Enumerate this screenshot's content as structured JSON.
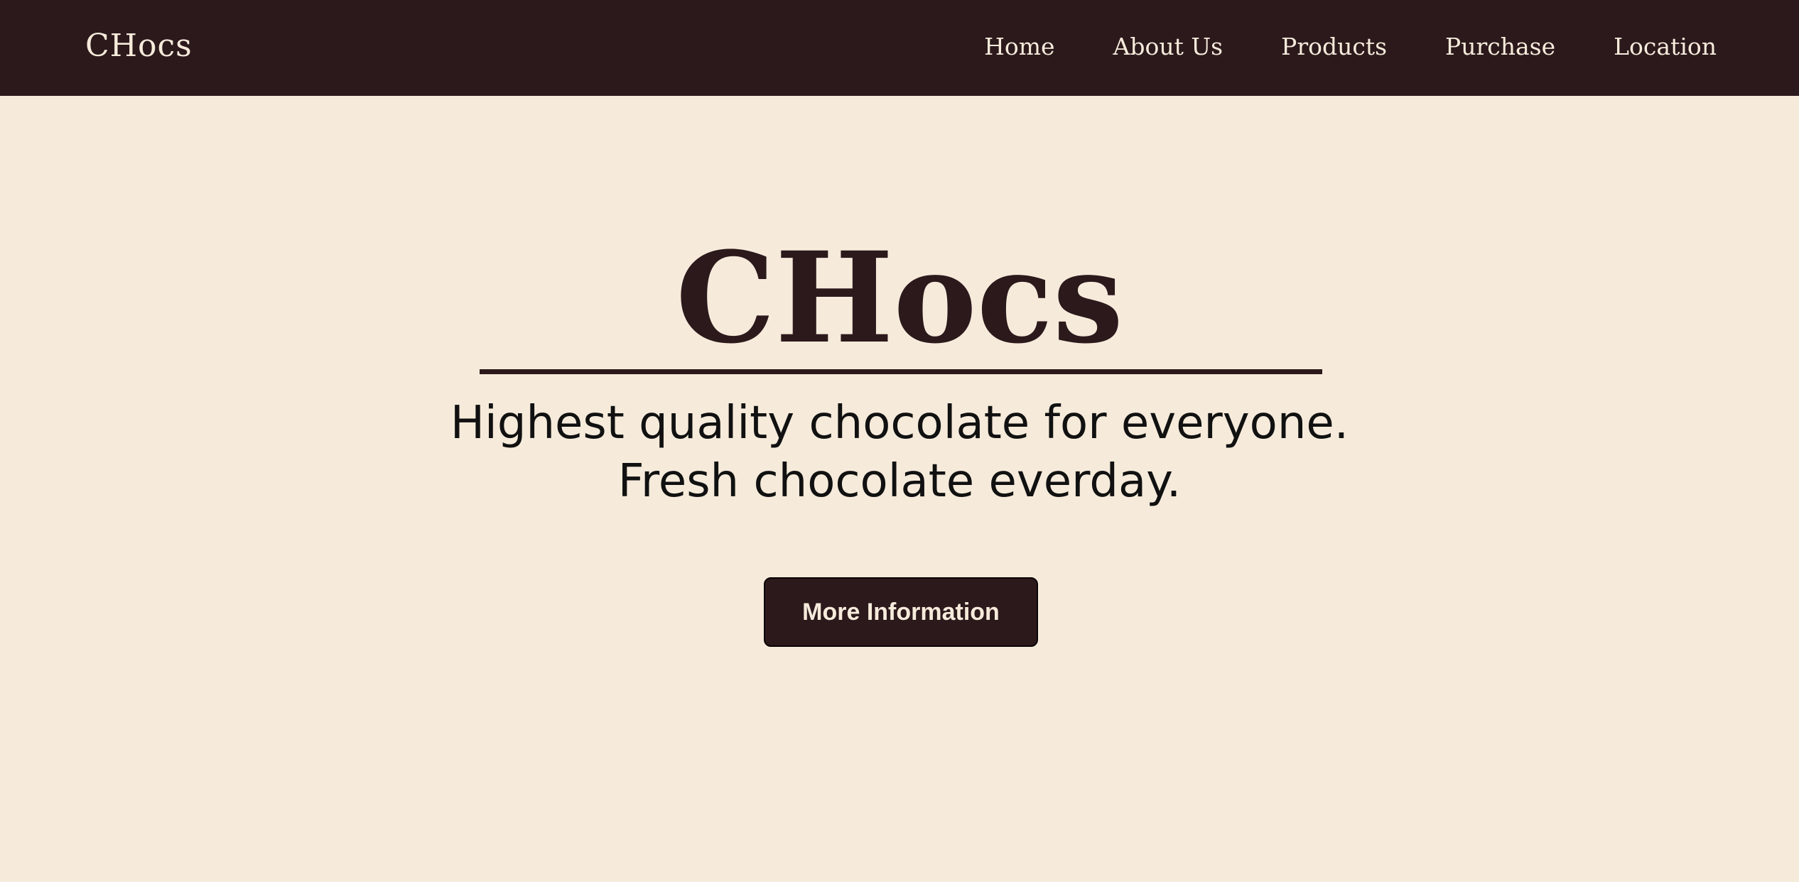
{
  "colors": {
    "navbar_bg": "#2c191c",
    "page_bg": "#f6ebdb",
    "accent": "#2c191c",
    "nav_text": "#f6ebdb",
    "button_text": "#f6ebdb"
  },
  "header": {
    "brand": "CHocs",
    "nav": [
      "Home",
      "About Us",
      "Products",
      "Purchase",
      "Location"
    ]
  },
  "hero": {
    "title": "CHocs",
    "tagline_line1": "Highest quality chocolate for everyone.",
    "tagline_line2": "Fresh chocolate everday.",
    "button_label": "More Information"
  }
}
